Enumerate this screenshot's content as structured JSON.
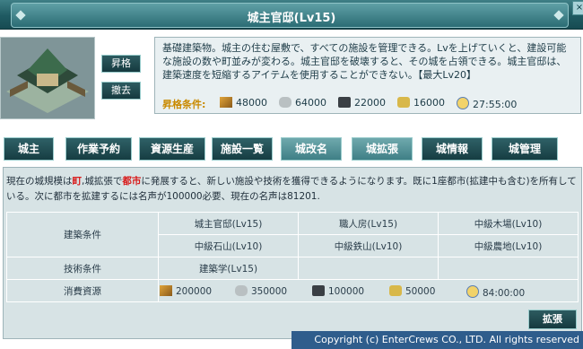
{
  "window": {
    "title": "城主官邸(Lv15)",
    "close_label": "×"
  },
  "building": {
    "upgrade_label": "昇格",
    "demolish_label": "撤去",
    "description": "基礎建築物。城主の住む屋敷で、すべての施設を管理できる。Lvを上げていくと、建設可能な施設の数や町並みが変わる。城主官邸を破壊すると、その城を占領できる。城主官邸は、建築速度を短縮するアイテムを使用することができない。【最大Lv20】",
    "upgrade_condition_label": "昇格条件:",
    "upgrade_costs": [
      {
        "icon": "wood-icon",
        "value": "48000"
      },
      {
        "icon": "stone-icon",
        "value": "64000"
      },
      {
        "icon": "iron-icon",
        "value": "22000"
      },
      {
        "icon": "food-icon",
        "value": "16000"
      },
      {
        "icon": "clock-icon",
        "value": "27:55:00"
      }
    ]
  },
  "tabs": [
    {
      "label": "城主"
    },
    {
      "label": "作業予約"
    },
    {
      "label": "資源生産"
    },
    {
      "label": "施設一覧"
    },
    {
      "label": "城改名"
    },
    {
      "label": "城拡張"
    },
    {
      "label": "城情報"
    },
    {
      "label": "城管理"
    }
  ],
  "expansion": {
    "intro_1": "現在の城規模は",
    "intro_red_1": "町",
    "intro_2": ",城拡張で",
    "intro_red_2": "都市",
    "intro_3": "に発展すると、新しい施設や技術を獲得できるようになります。既に1座都市(拡建中も含む)を所有している。次に都市を拡建するには名声が100000必要、現在の名声は81201.",
    "building_condition_label": "建築条件",
    "building_conditions": [
      [
        "城主官邸(Lv15)",
        "職人房(Lv15)",
        "中級木場(Lv10)"
      ],
      [
        "中級石山(Lv10)",
        "中級鉄山(Lv10)",
        "中級農地(Lv10)"
      ]
    ],
    "tech_condition_label": "技術条件",
    "tech_condition": "建築学(Lv15)",
    "cost_label": "消費資源",
    "costs": [
      {
        "icon": "wood-icon",
        "value": "200000"
      },
      {
        "icon": "stone-icon",
        "value": "350000"
      },
      {
        "icon": "iron-icon",
        "value": "100000"
      },
      {
        "icon": "food-icon",
        "value": "50000"
      },
      {
        "icon": "clock-icon",
        "value": "84:00:00"
      }
    ],
    "expand_label": "拡張"
  },
  "footer": {
    "copyright": "Copyright (c) EnterCrews CO., LTD. All rights reserved"
  }
}
